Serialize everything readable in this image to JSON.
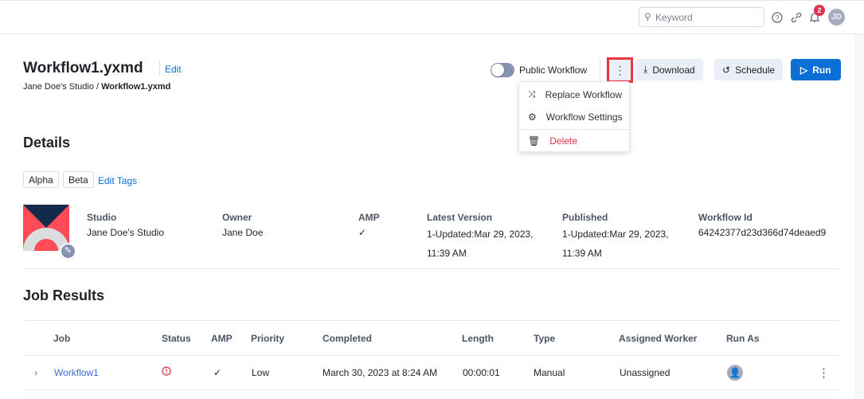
{
  "header": {
    "search_placeholder": "Keyword",
    "notifications_count": "2",
    "avatar_initials": "JD"
  },
  "workflow": {
    "title": "Workflow1.yxmd",
    "edit_label": "Edit",
    "breadcrumb_studio": "Jane Doe's Studio",
    "breadcrumb_sep": "/",
    "breadcrumb_current": "Workflow1.yxmd"
  },
  "actions": {
    "public_label": "Public Workflow",
    "public_on": false,
    "download": "Download",
    "schedule": "Schedule",
    "run": "Run"
  },
  "menu": {
    "items": [
      {
        "label": "Replace Workflow",
        "icon": "shuffle-icon"
      },
      {
        "label": "Workflow Settings",
        "icon": "gear-icon"
      },
      {
        "label": "Delete",
        "icon": "trash-icon"
      }
    ]
  },
  "details": {
    "heading": "Details",
    "tags": [
      "Alpha",
      "Beta"
    ],
    "edit_tags": "Edit Tags",
    "fields": [
      {
        "label": "Studio",
        "value": "Jane Doe's Studio"
      },
      {
        "label": "Owner",
        "value": "Jane Doe"
      },
      {
        "label": "AMP",
        "value": "✓"
      },
      {
        "label": "Latest Version",
        "value": "1-Updated:Mar 29, 2023, 11:39 AM"
      },
      {
        "label": "Published",
        "value": "1-Updated:Mar 29, 2023, 11:39 AM"
      },
      {
        "label": "Workflow Id",
        "value": "64242377d23d366d74deaed9"
      }
    ]
  },
  "jobs": {
    "heading": "Job Results",
    "columns": [
      "Job",
      "Status",
      "AMP",
      "Priority",
      "Completed",
      "Length",
      "Type",
      "Assigned Worker",
      "Run As"
    ],
    "rows": [
      {
        "job": "Workflow1",
        "status": "error",
        "amp": "✓",
        "priority": "Low",
        "completed": "March 30, 2023 at 8:24 AM",
        "length": "00:00:01",
        "type": "Manual",
        "worker": "Unassigned"
      }
    ]
  },
  "colors": {
    "primary": "#0b6fd6",
    "danger": "#e0314b",
    "highlight": "#e8383d"
  }
}
